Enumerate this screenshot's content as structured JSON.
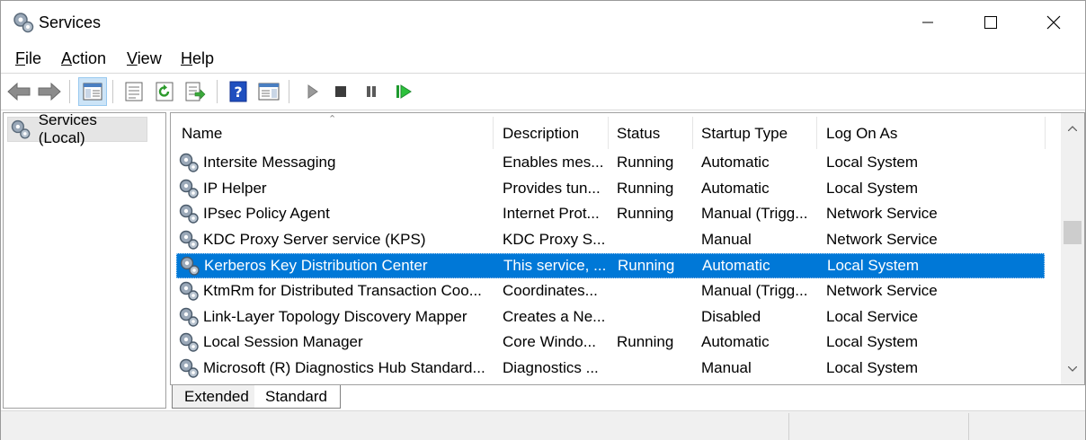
{
  "window": {
    "title": "Services",
    "icon": "gears-icon"
  },
  "menu": {
    "file": "File",
    "action": "Action",
    "view": "View",
    "help": "Help"
  },
  "toolbar": {
    "icons": [
      "back-arrow-icon",
      "forward-arrow-icon",
      "show-hide-console-tree-icon",
      "properties-icon",
      "refresh-icon",
      "export-list-icon",
      "help-icon",
      "show-action-pane-icon",
      "start-service-icon",
      "stop-service-icon",
      "pause-service-icon",
      "restart-service-icon"
    ]
  },
  "tree": {
    "root_label": "Services (Local)"
  },
  "list": {
    "columns": {
      "name": "Name",
      "description": "Description",
      "status": "Status",
      "startup_type": "Startup Type",
      "log_on_as": "Log On As"
    },
    "rows": [
      {
        "name": "Intersite Messaging",
        "description": "Enables mes...",
        "status": "Running",
        "startup_type": "Automatic",
        "log_on_as": "Local System",
        "selected": false
      },
      {
        "name": "IP Helper",
        "description": "Provides tun...",
        "status": "Running",
        "startup_type": "Automatic",
        "log_on_as": "Local System",
        "selected": false
      },
      {
        "name": "IPsec Policy Agent",
        "description": "Internet Prot...",
        "status": "Running",
        "startup_type": "Manual (Trigg...",
        "log_on_as": "Network Service",
        "selected": false
      },
      {
        "name": "KDC Proxy Server service (KPS)",
        "description": "KDC Proxy S...",
        "status": "",
        "startup_type": "Manual",
        "log_on_as": "Network Service",
        "selected": false
      },
      {
        "name": "Kerberos Key Distribution Center",
        "description": "This service, ...",
        "status": "Running",
        "startup_type": "Automatic",
        "log_on_as": "Local System",
        "selected": true
      },
      {
        "name": "KtmRm for Distributed Transaction Coo...",
        "description": "Coordinates...",
        "status": "",
        "startup_type": "Manual (Trigg...",
        "log_on_as": "Network Service",
        "selected": false
      },
      {
        "name": "Link-Layer Topology Discovery Mapper",
        "description": "Creates a Ne...",
        "status": "",
        "startup_type": "Disabled",
        "log_on_as": "Local Service",
        "selected": false
      },
      {
        "name": "Local Session Manager",
        "description": "Core Windo...",
        "status": "Running",
        "startup_type": "Automatic",
        "log_on_as": "Local System",
        "selected": false
      },
      {
        "name": "Microsoft (R) Diagnostics Hub Standard...",
        "description": "Diagnostics ...",
        "status": "",
        "startup_type": "Manual",
        "log_on_as": "Local System",
        "selected": false
      }
    ]
  },
  "tabs": {
    "extended": "Extended",
    "standard": "Standard"
  },
  "colors": {
    "selection": "#0078d7",
    "toolbar_active": "#cce4f7"
  }
}
